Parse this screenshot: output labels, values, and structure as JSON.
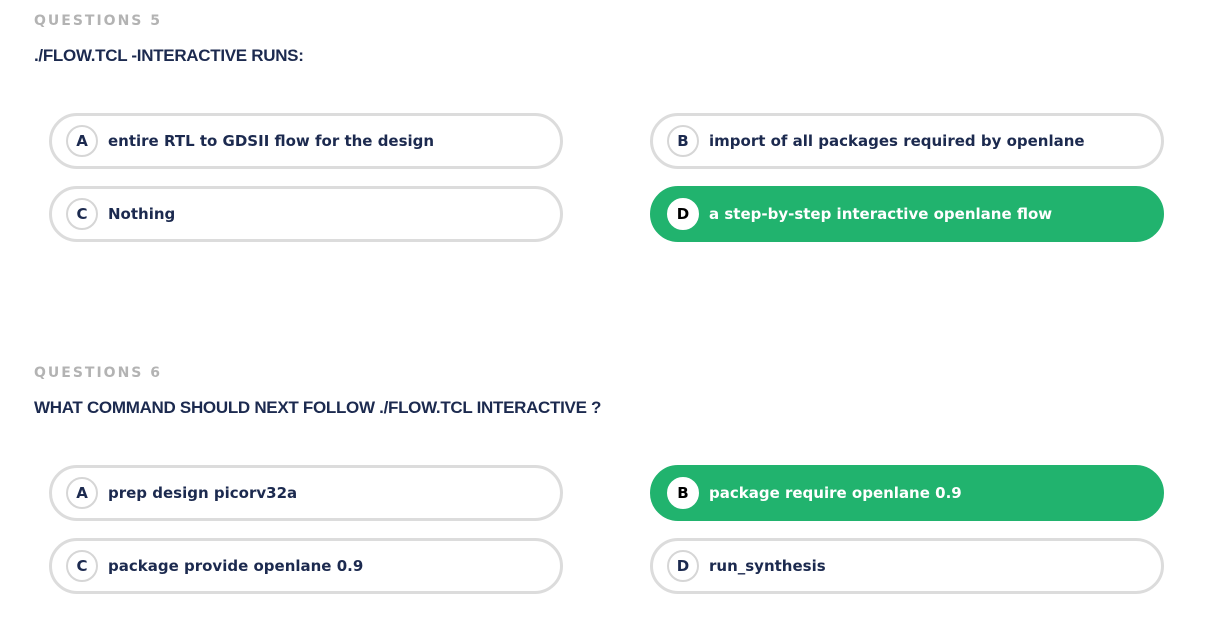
{
  "colors": {
    "selected": "#21b36e",
    "title": "#1c2a4f",
    "label": "#b3b3b3",
    "border": "#dcdcdc"
  },
  "questions": [
    {
      "label": "QUESTIONS 5",
      "title": "./FLOW.TCL -INTERACTIVE RUNS:",
      "selected": "D",
      "options": [
        {
          "letter": "A",
          "text": "entire RTL to GDSII flow for the design"
        },
        {
          "letter": "B",
          "text": "import of all packages required by openlane"
        },
        {
          "letter": "C",
          "text": "Nothing"
        },
        {
          "letter": "D",
          "text": "a step-by-step interactive openlane flow"
        }
      ]
    },
    {
      "label": "QUESTIONS 6",
      "title": "WHAT COMMAND SHOULD NEXT FOLLOW ./FLOW.TCL INTERACTIVE ?",
      "selected": "B",
      "options": [
        {
          "letter": "A",
          "text": "prep design picorv32a"
        },
        {
          "letter": "B",
          "text": "package require openlane 0.9"
        },
        {
          "letter": "C",
          "text": "package provide openlane 0.9"
        },
        {
          "letter": "D",
          "text": "run_synthesis"
        }
      ]
    }
  ]
}
